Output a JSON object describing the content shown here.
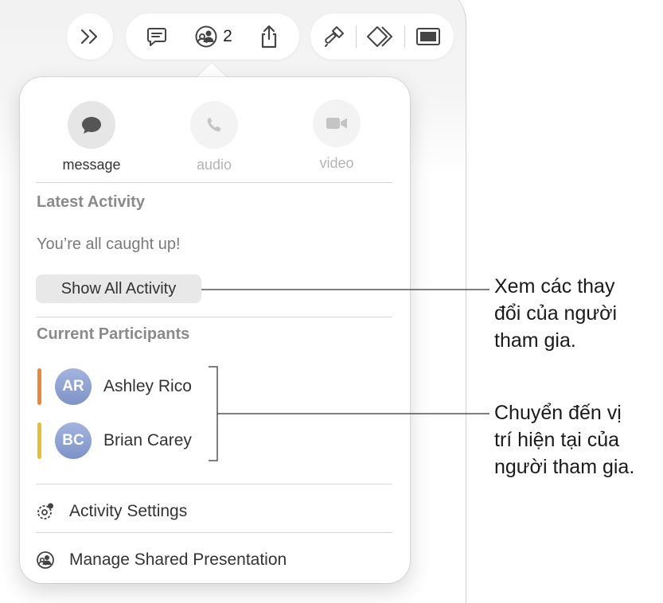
{
  "toolbar": {
    "collaborators_count": "2",
    "icons": [
      "chevrons-right-icon",
      "comment-icon",
      "collaboration-icon",
      "share-icon",
      "format-brush-icon",
      "animate-icon",
      "document-icon"
    ]
  },
  "communication": [
    {
      "label": "message",
      "icon": "message-bubble-icon",
      "enabled": true
    },
    {
      "label": "audio",
      "icon": "phone-icon",
      "enabled": false
    },
    {
      "label": "video",
      "icon": "video-camera-icon",
      "enabled": false
    }
  ],
  "latest_activity": {
    "title": "Latest Activity",
    "status": "You’re all caught up!",
    "button_label": "Show All Activity"
  },
  "participants": {
    "title": "Current Participants",
    "list": [
      {
        "initials": "AR",
        "name": "Ashley Rico",
        "color": "#f0862f"
      },
      {
        "initials": "BC",
        "name": "Brian Carey",
        "color": "#e8c02a"
      }
    ]
  },
  "menu": [
    {
      "label": "Activity Settings",
      "icon": "activity-settings-icon"
    },
    {
      "label": "Manage Shared Presentation",
      "icon": "manage-sharing-icon"
    }
  ],
  "callouts": {
    "activity": [
      "Xem các thay",
      "đổi của người",
      "tham gia."
    ],
    "participants": [
      "Chuyển đến vị",
      "trí hiện tại của",
      "người tham gia."
    ]
  },
  "colors": {
    "enabled_icon_bg": "#e6e6e6",
    "disabled_icon_bg": "#f3f3f3",
    "enabled_label": "#333333",
    "disabled_label": "#b3b3b3"
  }
}
